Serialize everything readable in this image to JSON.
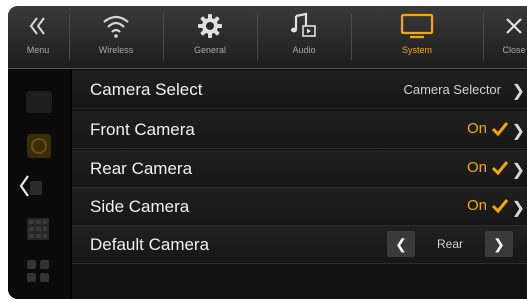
{
  "tabs": [
    {
      "label": "Menu",
      "icon": "menu-back-icon"
    },
    {
      "label": "Wireless",
      "icon": "wifi-icon"
    },
    {
      "label": "General",
      "icon": "gear-icon"
    },
    {
      "label": "Audio",
      "icon": "music-note-icon"
    },
    {
      "label": "System",
      "icon": "monitor-icon",
      "active": true
    },
    {
      "label": "Close",
      "icon": "close-icon"
    }
  ],
  "accent_color": "#f5a800",
  "settings": {
    "camera_select": {
      "label": "Camera Select",
      "value": "Camera Selector"
    },
    "front_camera": {
      "label": "Front Camera",
      "value": "On"
    },
    "rear_camera": {
      "label": "Rear Camera",
      "value": "On"
    },
    "side_camera": {
      "label": "Side Camera",
      "value": "On"
    },
    "default_camera": {
      "label": "Default Camera",
      "value": "Rear"
    }
  }
}
